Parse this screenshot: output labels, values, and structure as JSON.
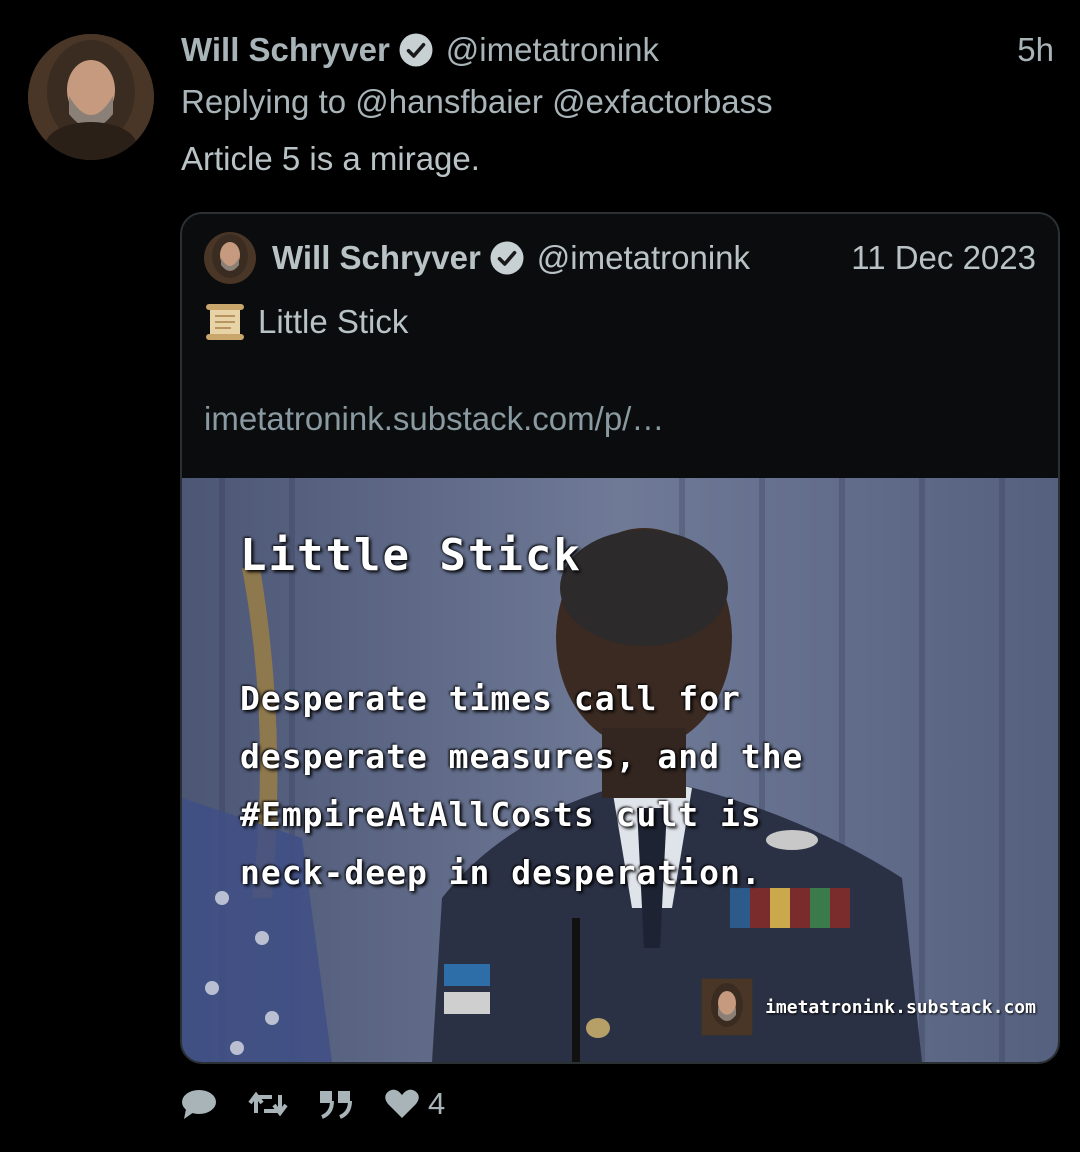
{
  "tweet": {
    "display_name": "Will Schryver",
    "handle": "@imetatronink",
    "time": "5h",
    "replying_prefix": "Replying to",
    "mentions": [
      "@hansfbaier",
      "@exfactorbass"
    ],
    "text": "Article 5 is a mirage."
  },
  "quote": {
    "display_name": "Will Schryver",
    "handle": "@imetatronink",
    "date": "11 Dec 2023",
    "title": "Little Stick",
    "title_icon": "scroll-icon",
    "link": "imetatronink.substack.com/p/…",
    "media": {
      "title": "Little Stick",
      "text": "Desperate times call for\ndesperate measures, and the\n#EmpireAtAllCosts cult is\nneck-deep in desperation.",
      "watermark": "imetatronink.substack.com"
    }
  },
  "actions": {
    "reply_icon": "reply-icon",
    "retweet_icon": "retweet-icon",
    "quote_icon": "quote-icon",
    "like_icon": "heart-icon",
    "like_count": "4"
  },
  "colors": {
    "background": "#000000",
    "text_muted": "#a8b4b8",
    "verified_badge": "#c7d0d3"
  }
}
